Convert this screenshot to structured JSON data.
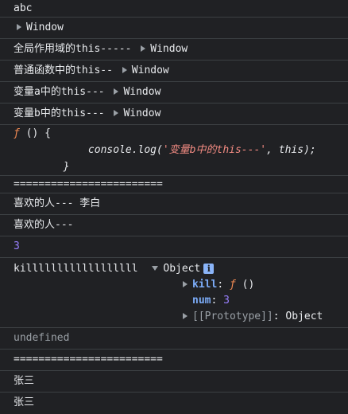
{
  "console": {
    "rows": [
      {
        "text": "abc"
      },
      {
        "value": "Window"
      },
      {
        "label": "全局作用域的this-----",
        "value": "Window"
      },
      {
        "label": "普通函数中的this--",
        "value": "Window"
      },
      {
        "label": "变量a中的this---",
        "value": "Window"
      },
      {
        "label": "变量b中的this---",
        "value": "Window"
      }
    ],
    "func": {
      "line1_sym": "ƒ",
      "line1_rest": " () {",
      "line2_prefix": "            console.log(",
      "line2_str": "'变量b中的this---'",
      "line2_suffix": ", this);",
      "line3": "        }"
    },
    "separator1": "========================",
    "love1": "喜欢的人--- 李白",
    "love2": "喜欢的人---",
    "number3": "3",
    "kill_text": "killllllllllllllllll",
    "object": {
      "title": "Object",
      "info_icon_text": "i",
      "kill_key": "kill",
      "colon": ":",
      "kill_value_sym": "ƒ",
      "kill_value_rest": " ()",
      "num_key": "num",
      "num_value": "3",
      "proto_key": "[[Prototype]]",
      "proto_value": "Object"
    },
    "undefined_text": "undefined",
    "separator2": "========================",
    "name1": "张三",
    "name2": "张三"
  },
  "colors": {
    "background": "#202124",
    "text": "#e8eaed",
    "function_symbol": "#f28b54",
    "key": "#7cacf8",
    "number": "#9980ff",
    "muted": "#9aa0a6"
  }
}
